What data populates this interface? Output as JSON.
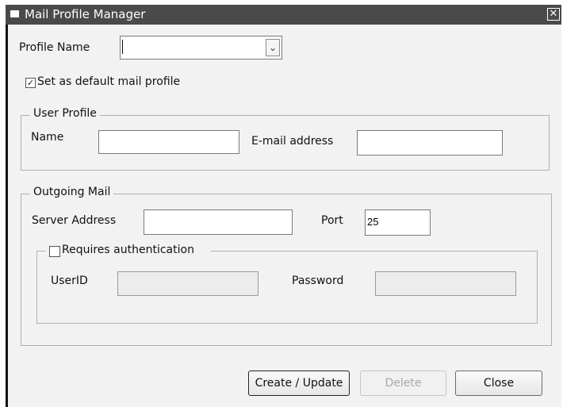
{
  "window": {
    "title": "Mail Profile Manager",
    "close_glyph": "✕"
  },
  "profile": {
    "label": "Profile Name",
    "value": "",
    "dropdown_glyph": "⌄"
  },
  "default_checkbox": {
    "label": "Set as default mail profile",
    "checked": true,
    "check_glyph": "✓"
  },
  "user_profile": {
    "legend": "User Profile",
    "name_label": "Name",
    "name_value": "",
    "email_label": "E-mail address",
    "email_value": ""
  },
  "outgoing_mail": {
    "legend": "Outgoing Mail",
    "server_label": "Server Address",
    "server_value": "",
    "port_label": "Port",
    "port_value": "25",
    "auth": {
      "label": "Requires authentication",
      "checked": false,
      "userid_label": "UserID",
      "userid_value": "",
      "password_label": "Password",
      "password_value": ""
    }
  },
  "buttons": {
    "create_update": "Create / Update",
    "delete": "Delete",
    "close": "Close"
  }
}
